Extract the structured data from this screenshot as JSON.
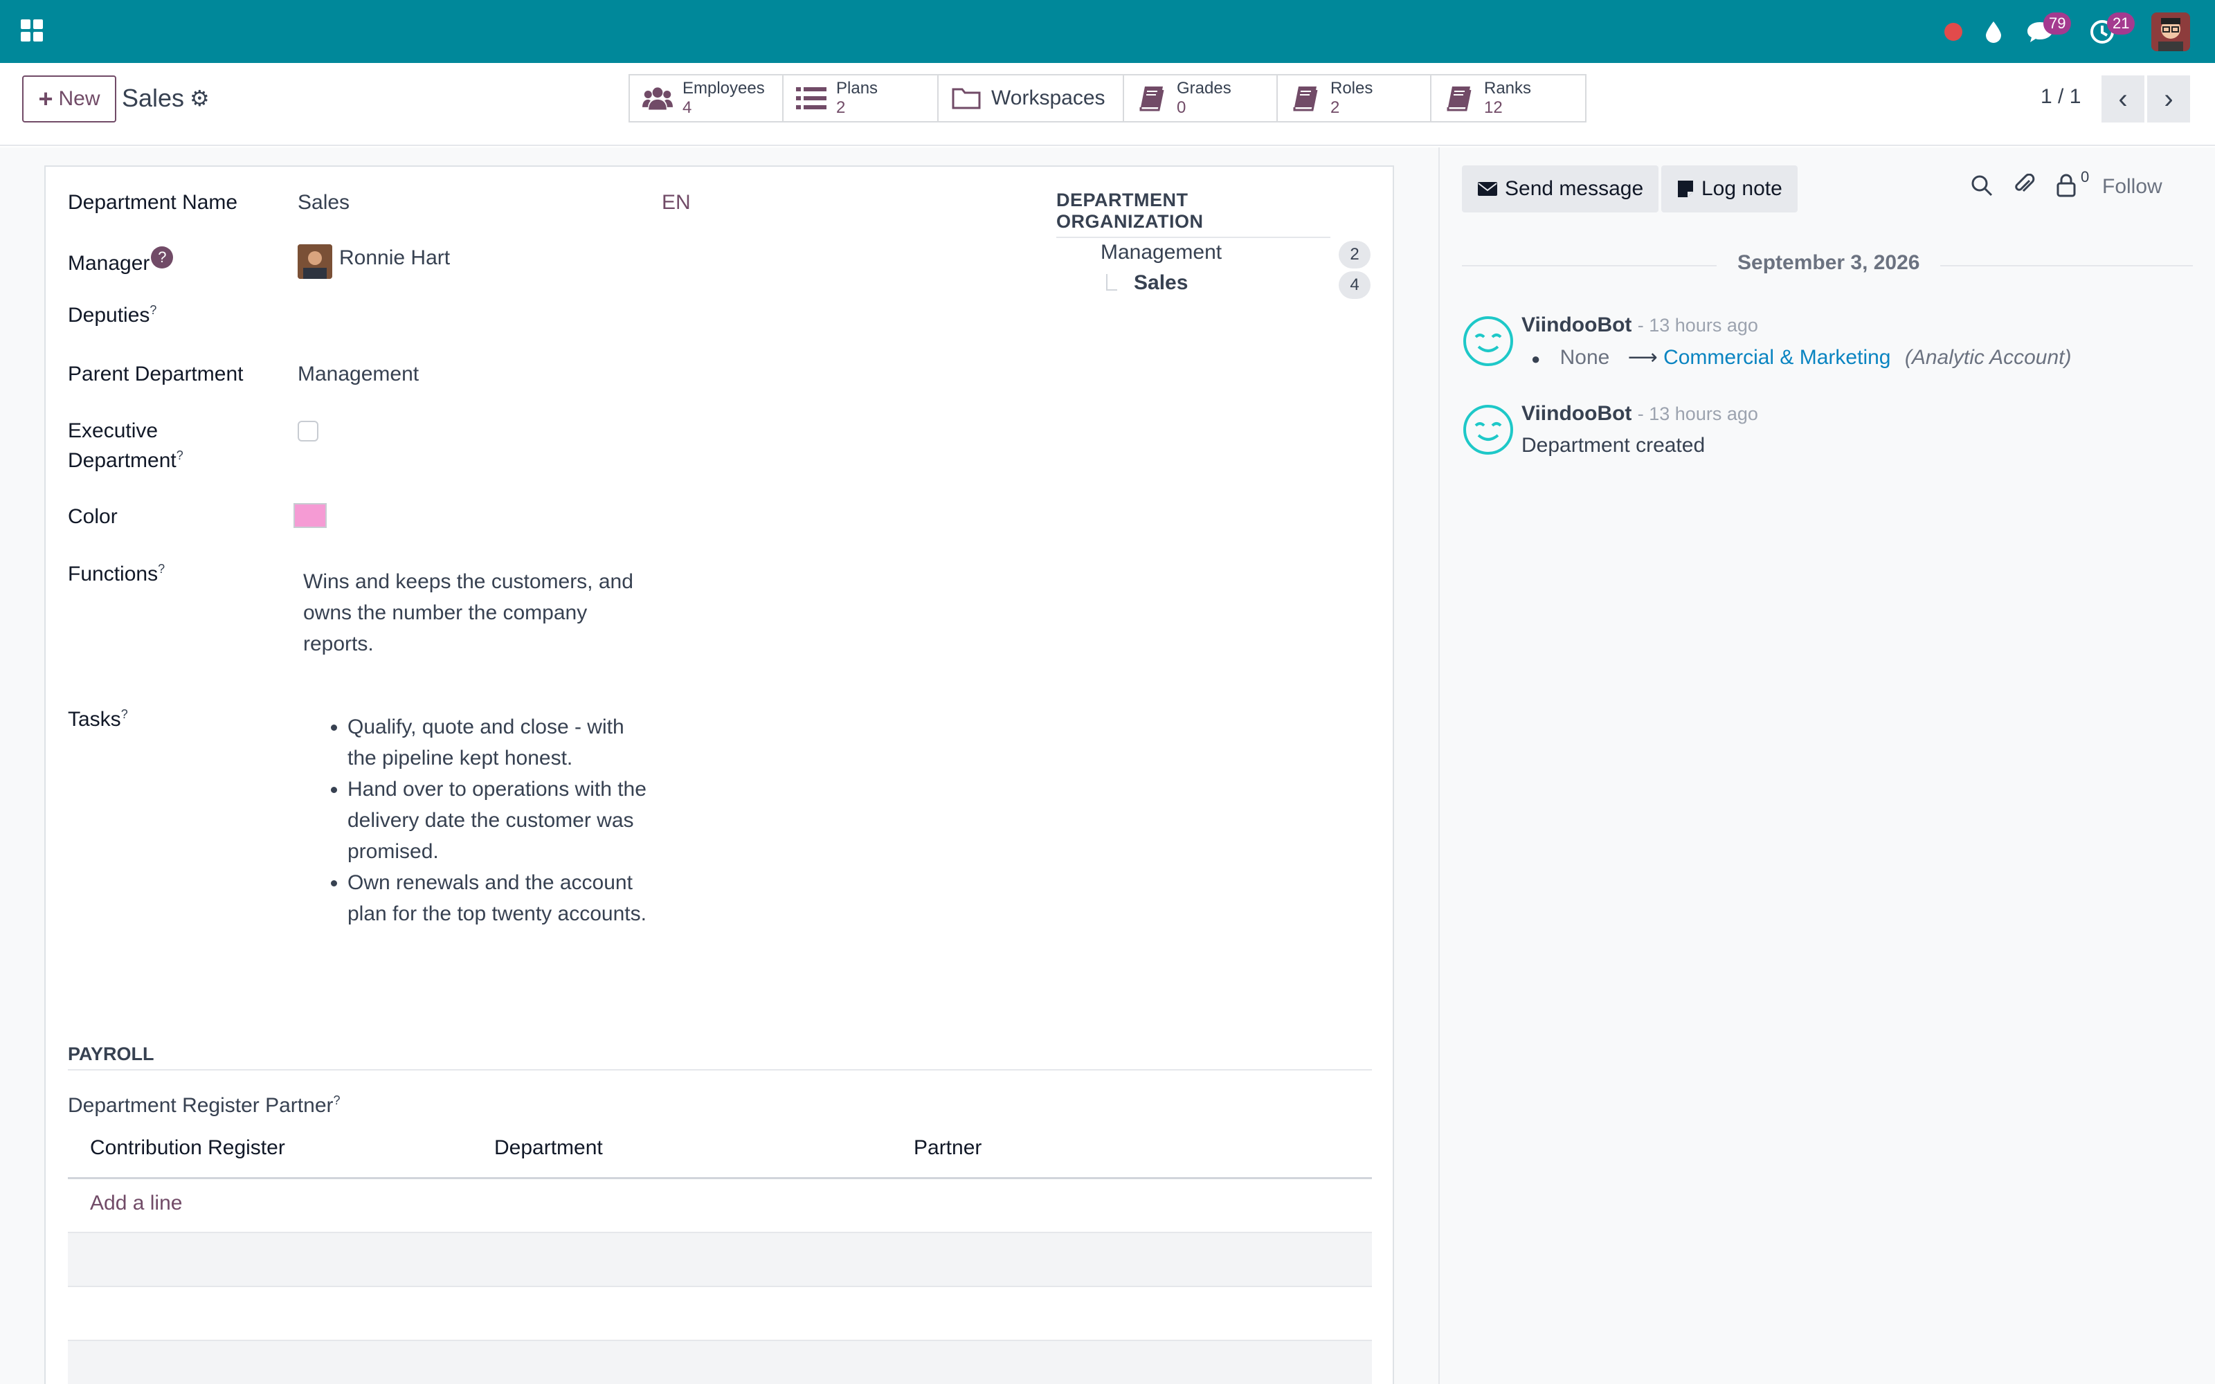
{
  "navbar": {
    "notifications": {
      "messages_count": "79",
      "activities_count": "21"
    }
  },
  "control_panel": {
    "new_label": "New",
    "record_title": "Sales",
    "smart_buttons": [
      {
        "label": "Employees",
        "count": "4",
        "icon": "users-icon"
      },
      {
        "label": "Plans",
        "count": "2",
        "icon": "list-icon"
      },
      {
        "label": "Workspaces",
        "count": "",
        "icon": "folder-icon"
      },
      {
        "label": "Grades",
        "count": "0",
        "icon": "book-icon"
      },
      {
        "label": "Roles",
        "count": "2",
        "icon": "book-icon"
      },
      {
        "label": "Ranks",
        "count": "12",
        "icon": "book-icon"
      }
    ],
    "pager": "1 / 1"
  },
  "form": {
    "department_name_label": "Department Name",
    "department_name_value": "Sales",
    "lang_code": "EN",
    "manager_label": "Manager",
    "manager_help": "?",
    "manager_value": "Ronnie Hart",
    "deputies_label": "Deputies",
    "parent_department_label": "Parent Department",
    "parent_department_value": "Management",
    "executive_label_line1": "Executive",
    "executive_label_line2": "Department",
    "color_label": "Color",
    "color_value": "#f59bd4",
    "functions_label": "Functions",
    "functions_value": "Wins and keeps the customers, and owns the number the company reports.",
    "tasks_label": "Tasks",
    "tasks": [
      "Qualify, quote and close - with the pipeline kept honest.",
      "Hand over to operations with the delivery date the customer was promised.",
      "Own renewals and the account plan for the top twenty accounts."
    ],
    "help_marker": "?"
  },
  "organization": {
    "title": "DEPARTMENT ORGANIZATION",
    "rows": [
      {
        "name": "Management",
        "count": "2"
      },
      {
        "name": "Sales",
        "count": "4"
      }
    ]
  },
  "payroll": {
    "title": "PAYROLL",
    "register_label": "Department Register Partner",
    "columns": [
      "Contribution Register",
      "Department",
      "Partner"
    ],
    "add_line": "Add a line"
  },
  "chatter": {
    "send_message": "Send message",
    "log_note": "Log note",
    "followers_count": "0",
    "follow": "Follow",
    "date": "September 3, 2026",
    "messages": [
      {
        "author": "ViindooBot",
        "time": "- 13 hours ago",
        "old": "None",
        "new": "Commercial & Marketing",
        "field": "(Analytic Account)"
      },
      {
        "author": "ViindooBot",
        "time": "- 13 hours ago",
        "body": "Department created"
      }
    ]
  },
  "colors": {
    "navbar": "#00889a",
    "brand": "#714b67",
    "link": "#0a84c1",
    "record_indicator": "#e24b4b"
  }
}
